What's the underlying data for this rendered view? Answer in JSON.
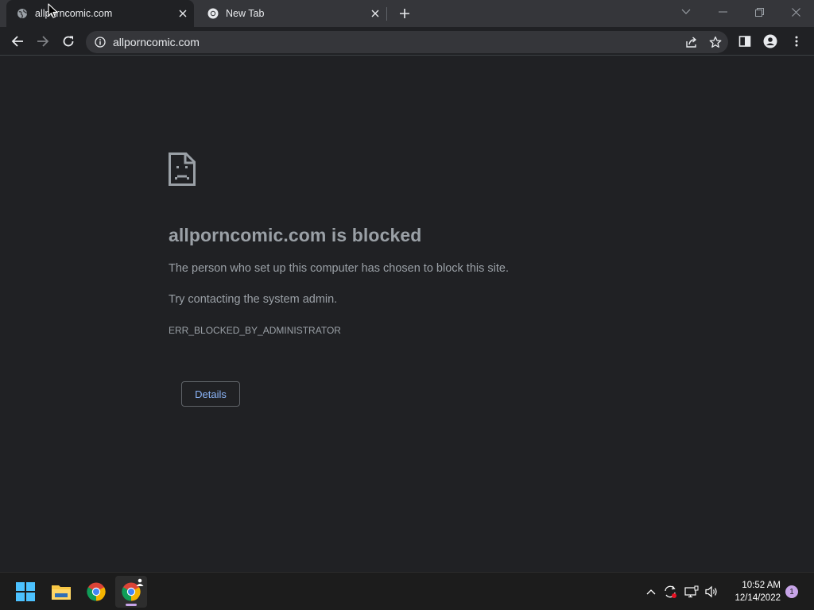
{
  "browser": {
    "tabs": [
      {
        "title": "allporncomic.com",
        "active": true
      },
      {
        "title": "New Tab",
        "active": false
      }
    ],
    "url": "allporncomic.com"
  },
  "error_page": {
    "title": "allporncomic.com is blocked",
    "message": "The person who set up this computer has chosen to block this site.",
    "suggestion": "Try contacting the system admin.",
    "error_code": "ERR_BLOCKED_BY_ADMINISTRATOR",
    "details_label": "Details"
  },
  "taskbar": {
    "time": "10:52 AM",
    "date": "12/14/2022",
    "notification_count": "1"
  },
  "colors": {
    "background": "#202124",
    "tabstrip": "#35363a",
    "link_blue": "#8ab4f8",
    "text_muted": "#9aa0a6"
  }
}
